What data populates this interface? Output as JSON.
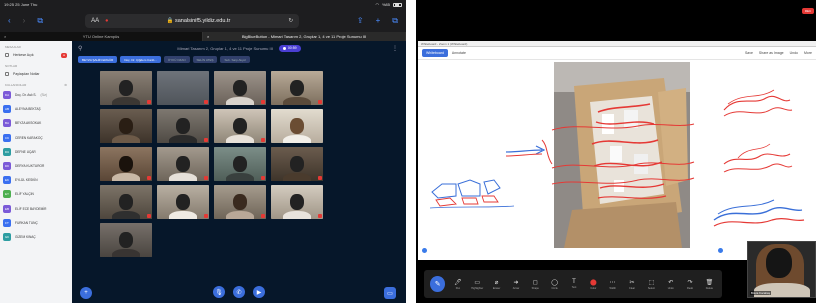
{
  "ipad": {
    "status": {
      "time": "19:25",
      "date": "25 June Thu",
      "battery": "%85"
    },
    "browser": {
      "aa": "AA",
      "url": "sanalsinif5.yildiz.edu.tr",
      "lock": "🔒"
    },
    "tabs": [
      {
        "label": "YTU Online Kampüs",
        "active": false
      },
      {
        "label": "BigBlueButton - Mimari Tasarım 2, Gruplar 1, 4 ve 11 Proje Sunumu III",
        "active": true
      }
    ],
    "sidebar": {
      "messages_header": "MESAJLAR",
      "public_chat": "Herkese Açık",
      "notes_header": "NOTLAR",
      "shared_notes": "Paylaşılan Notlar",
      "users_header": "KULLANICILAR",
      "users": [
        {
          "initials": "DA",
          "name": "Doç. Dr. Aslı S.",
          "tag": "(Siz)"
        },
        {
          "initials": "AB",
          "name": "ALEYNA BEKTAŞ",
          "tag": ""
        },
        {
          "initials": "BA",
          "name": "BEYZA AKSOKAK",
          "tag": ""
        },
        {
          "initials": "CK",
          "name": "CEREN KARAKOÇ",
          "tag": ""
        },
        {
          "initials": "DU",
          "name": "DEFNE UÇAR",
          "tag": ""
        },
        {
          "initials": "DK",
          "name": "DERYA KUKTUROR",
          "tag": ""
        },
        {
          "initials": "EK",
          "name": "EYLÜL KESKİN",
          "tag": ""
        },
        {
          "initials": "EY",
          "name": "ELİF YALÇIN",
          "tag": ""
        },
        {
          "initials": "EB",
          "name": "ELİF ECE BAYDEMİR",
          "tag": ""
        },
        {
          "initials": "FT",
          "name": "FURKAN TUNÇ",
          "tag": ""
        },
        {
          "initials": "GK",
          "name": "GİZEM KINAÇ",
          "tag": ""
        }
      ]
    },
    "meeting": {
      "title": "Mimari Tasarım 2, Gruplar 1, 4 ve 11 Proje Sunumu III",
      "recording": "00:59",
      "talkers": [
        "BEYZA ŞAHİN ERGÜR",
        "Doç. Dr. Çiğdem Canb...",
        "ÖYKÜ OZAN",
        "SELİN ATEŞ",
        "Sub. Sarp Akyol"
      ]
    }
  },
  "zoom": {
    "rec_label": "REC",
    "window_title": "Whiteboard - Zoom 1 (Whiteboard)",
    "tabs": [
      "Whiteboard",
      "Annotate"
    ],
    "toolbar_right": [
      "Save",
      "Share as Image",
      "Undo",
      "More"
    ],
    "tools": [
      {
        "icon": "✎",
        "label": ""
      },
      {
        "icon": "🖊",
        "label": "Pen"
      },
      {
        "icon": "▭",
        "label": "Highlighter"
      },
      {
        "icon": "⌀",
        "label": "Eraser"
      },
      {
        "icon": "➜",
        "label": "Arrow"
      },
      {
        "icon": "◻",
        "label": "Shape"
      },
      {
        "icon": "◯",
        "label": "Circle"
      },
      {
        "icon": "T",
        "label": "Text"
      },
      {
        "icon": "⬤",
        "label": "Color"
      },
      {
        "icon": "⋯",
        "label": "Width"
      },
      {
        "icon": "✂",
        "label": "Clear"
      },
      {
        "icon": "⬚",
        "label": "Select"
      },
      {
        "icon": "↶",
        "label": "Undo"
      },
      {
        "icon": "↷",
        "label": "Redo"
      },
      {
        "icon": "🗑",
        "label": "Delete"
      }
    ],
    "selfcam_name": "Büşra Kocabaş"
  }
}
